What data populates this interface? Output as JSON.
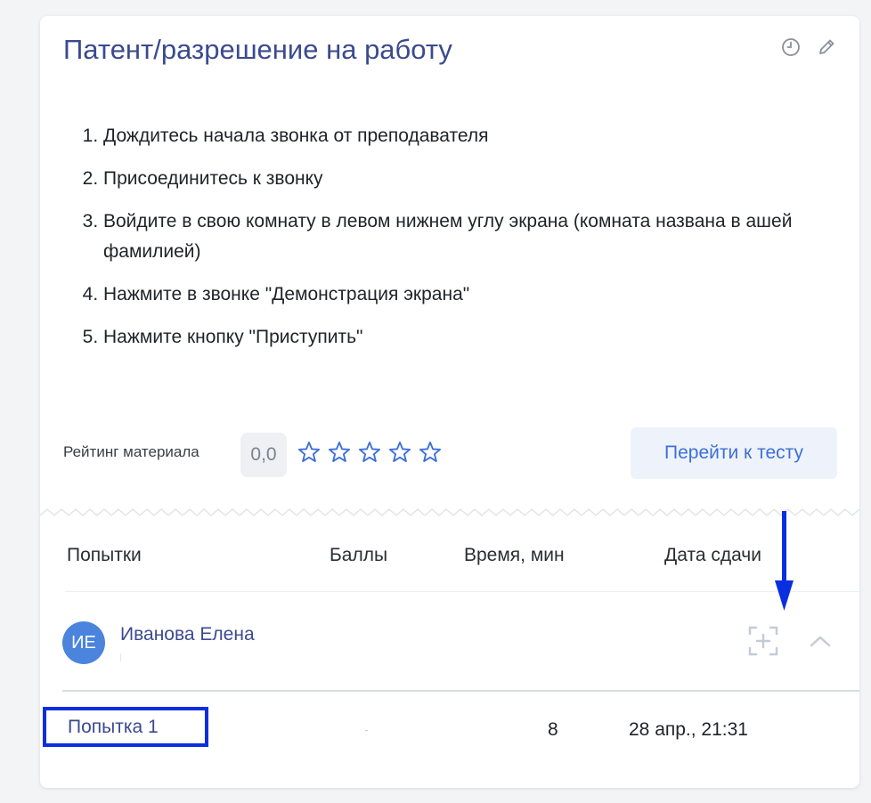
{
  "card": {
    "title": "Патент/разрешение на работу",
    "icons": {
      "history": "clock-icon",
      "edit": "pencil-icon"
    }
  },
  "instructions": [
    "Дождитесь начала звонка от преподавателя",
    "Присоединитесь к звонку",
    "Войдите в свою комнату в левом нижнем углу экрана (комната названа в ашей фамилией)",
    "Нажмите в звонке \"Демонстрация экрана\"",
    "Нажмите кнопку \"Приступить\""
  ],
  "rating": {
    "label": "Рейтинг материала",
    "value": "0,0",
    "stars_total": 5,
    "stars_filled": 0,
    "star_color": "#3d6fd9"
  },
  "test_button": {
    "label": "Перейти к тесту"
  },
  "table": {
    "headers": {
      "attempts": "Попытки",
      "score": "Баллы",
      "time": "Время, мин",
      "date": "Дата сдачи"
    }
  },
  "student": {
    "initials": "ИЕ",
    "name": "Иванова Елена",
    "avatar_color": "#4a84dd",
    "icons": {
      "expand": "expand-frame-icon",
      "collapse": "chevron-up-icon"
    }
  },
  "attempt": {
    "label": "Попытка 1",
    "time": "8",
    "date": "28 апр., 21:31"
  },
  "annotation": {
    "color": "#0a2fe0"
  }
}
